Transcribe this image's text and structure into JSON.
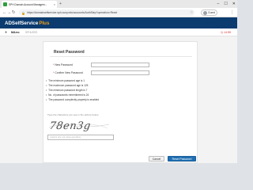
{
  "browser": {
    "tab_title": "SPH Domain Account Managem...",
    "tab_close": "×",
    "new_tab": "+",
    "controls": {
      "minimize": "–",
      "maximize": "☐",
      "close": "✕"
    },
    "url": "https://domainselfservice.sph.cuny.edu/accounts/AuthStep?operation=Reset",
    "profile_label": "Guest",
    "back": "←",
    "forward": "→",
    "reload": "↻",
    "star": "☆",
    "menu": "⋮"
  },
  "app": {
    "brand": "ADSelfService",
    "brand_plus": "Plus"
  },
  "userbar": {
    "user_name": "MArro",
    "domain": "SPHUSSS",
    "timer": "14:55"
  },
  "form": {
    "title": "Reset Password",
    "new_password_label": "New Password",
    "confirm_password_label": "Confirm New Password",
    "required_mark": "*",
    "policy": [
      "The minimum password age is 1",
      "The maximum password age is 125",
      "The minimum password length is 7",
      "No. of passwords remembered is 24",
      "The password complexity property is enabled"
    ],
    "captcha_hint": "Type the characters you see in the picture below.",
    "captcha_text": "78en3g",
    "captcha_placeholder": "Letters are not case-sensitive",
    "cancel_label": "Cancel",
    "reset_label": "Reset Password"
  },
  "colors": {
    "header_bg": "#0b3b6f",
    "accent": "#1f6fb2",
    "brand_plus": "#f3a01a",
    "timer": "#d32f2f"
  },
  "icons": {
    "favicon": "adselfservice-favicon",
    "lock": "lock-icon",
    "user": "user-icon",
    "clock": "clock-icon"
  }
}
